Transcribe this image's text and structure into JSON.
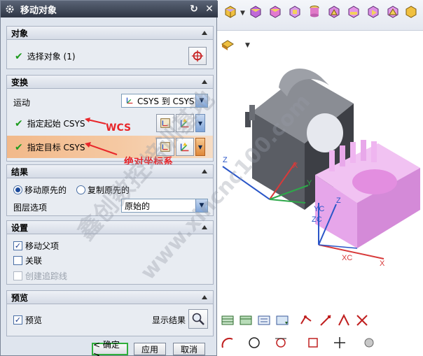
{
  "dialog": {
    "title": "移动对象",
    "sections": {
      "object": {
        "label": "对象",
        "select_label": "选择对象 (1)"
      },
      "transform": {
        "label": "变换",
        "motion_label": "运动",
        "motion_value": "CSYS 到 CSYS",
        "from_csys_label": "指定起始 CSYS",
        "to_csys_label": "指定目标 CSYS"
      },
      "result": {
        "label": "结果",
        "move_original": "移动原先的",
        "copy_original": "复制原先的",
        "layer_option_label": "图层选项",
        "layer_option_value": "原始的"
      },
      "settings": {
        "label": "设置",
        "move_parent": "移动父项",
        "associative": "关联",
        "create_trace": "创建追踪线"
      },
      "preview": {
        "label": "预览",
        "preview_check": "预览",
        "show_result": "显示结果"
      }
    },
    "buttons": {
      "ok": "< 确定 >",
      "apply": "应用",
      "cancel": "取消"
    }
  },
  "annotations": {
    "wcs": "WCS",
    "absolute_csys": "绝对坐标系"
  },
  "viewport": {
    "axis_labels": {
      "z1": "Z",
      "x1": "X",
      "y1": "Y",
      "z2": "Z",
      "yc": "YC",
      "zc": "ZC",
      "xc": "XC",
      "x2": "X"
    }
  },
  "watermark": {
    "line1": "鑫创数控培训基地",
    "line2": "www.xincnc100.com"
  },
  "colors": {
    "accent_check": "#1e9b1e",
    "annotation": "#e8262a",
    "highlight": "#f2b98a",
    "part_gray": "#3d3f45",
    "part_pink": "#e6a6ea"
  }
}
